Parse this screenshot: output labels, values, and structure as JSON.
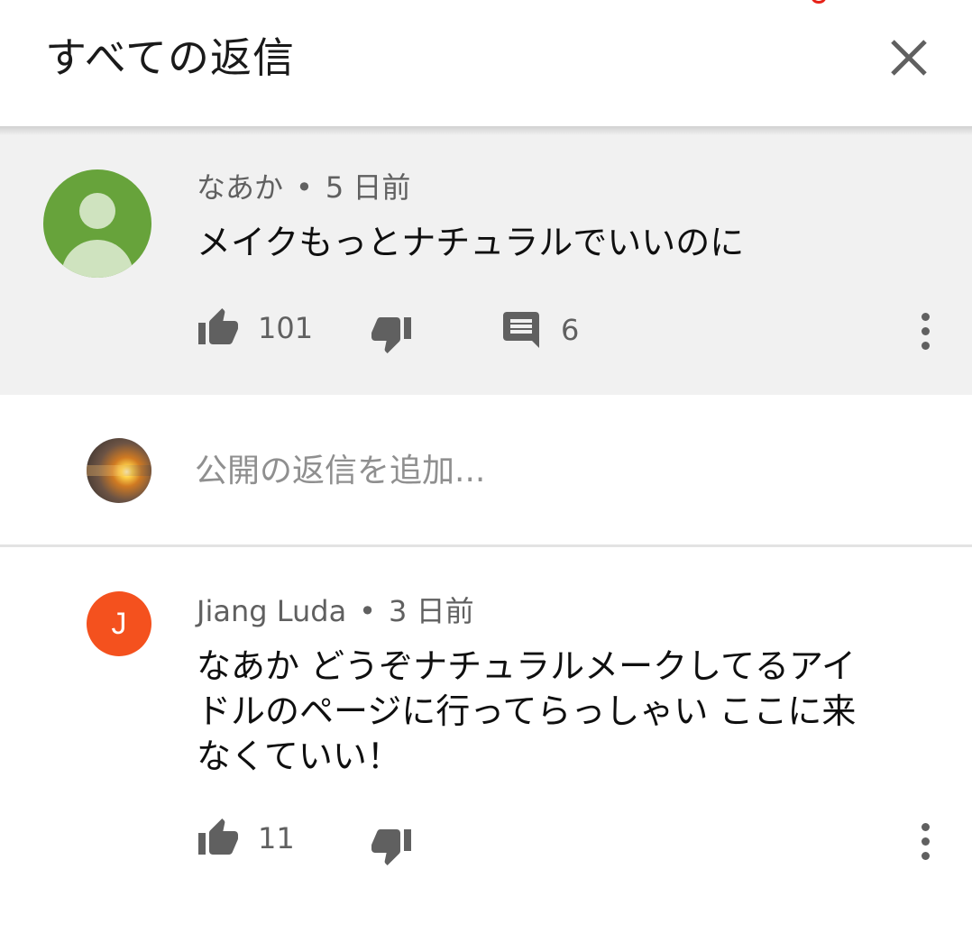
{
  "header": {
    "title": "すべての返信"
  },
  "parent_comment": {
    "author": "なあか",
    "separator": "•",
    "time": "5 日前",
    "text": "メイクもっとナチュラルでいいのに",
    "likes": "101",
    "replies": "6"
  },
  "reply_input": {
    "placeholder": "公開の返信を追加..."
  },
  "replies": [
    {
      "author": "Jiang Luda",
      "separator": "•",
      "time": "3 日前",
      "avatar_letter": "J",
      "text_lines": [
        "なあか どうぞナチュラルメークしてるアイ",
        "ドルのページに行ってらっしゃい ここに来",
        "なくていい！"
      ],
      "likes": "11"
    }
  ],
  "colors": {
    "accent_avatar": "#f4511e",
    "default_avatar": "#67a33b",
    "parent_bg": "#f1f1f1"
  }
}
